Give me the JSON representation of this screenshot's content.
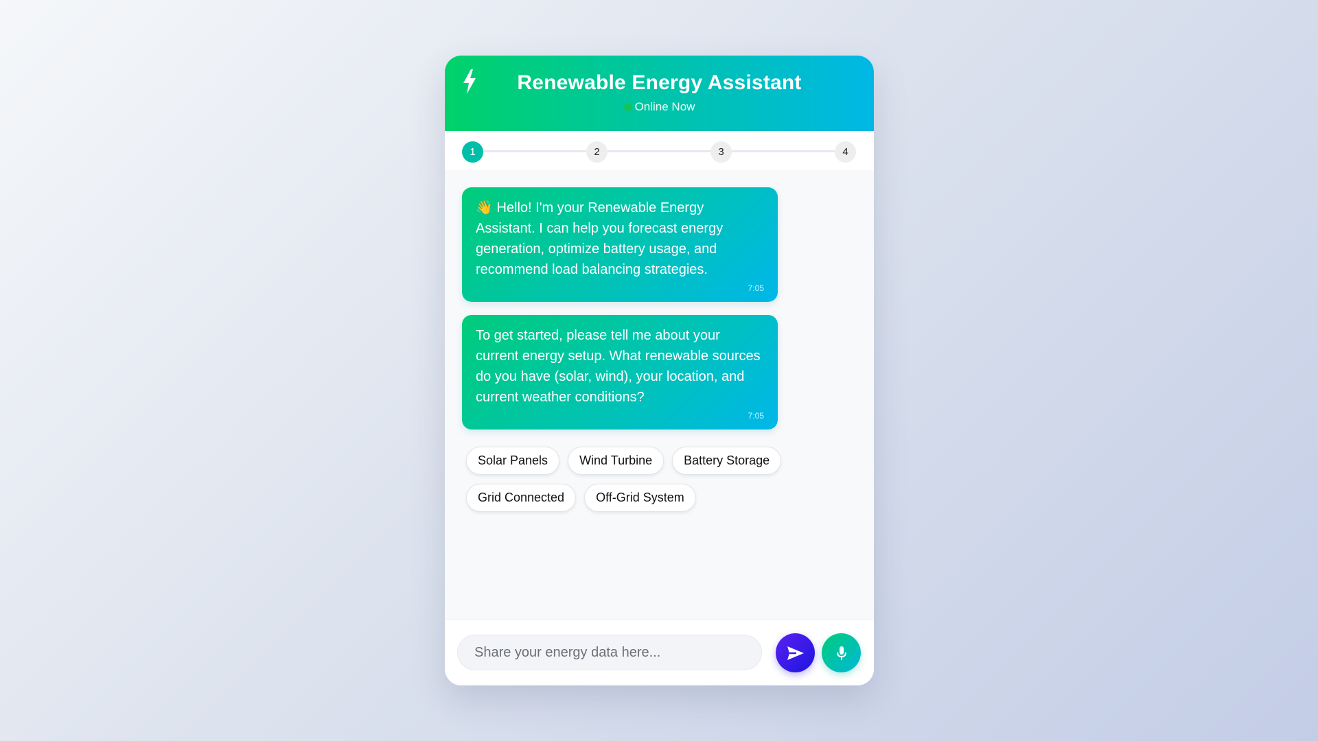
{
  "header": {
    "title": "Renewable Energy Assistant",
    "status": "Online Now",
    "icon": "lightning-bolt-icon"
  },
  "stepper": {
    "steps": [
      "1",
      "2",
      "3",
      "4"
    ],
    "active_step": 1
  },
  "messages": [
    {
      "text": "👋 Hello! I'm your Renewable Energy Assistant. I can help you forecast energy generation, optimize battery usage, and recommend load balancing strategies.",
      "time": "7:05"
    },
    {
      "text": "To get started, please tell me about your current energy setup. What renewable sources do you have (solar, wind), your location, and current weather conditions?",
      "time": "7:05"
    }
  ],
  "quick_replies": [
    "Solar Panels",
    "Wind Turbine",
    "Battery Storage",
    "Grid Connected",
    "Off-Grid System"
  ],
  "input": {
    "placeholder": "Share your energy data here...",
    "value": ""
  },
  "buttons": {
    "send_icon": "send-icon",
    "mic_icon": "microphone-icon"
  },
  "colors": {
    "header_gradient_start": "#00d26a",
    "header_gradient_end": "#00b8e6",
    "active_step": "#00bfa8",
    "send_button": "#3b18e8",
    "status_dot": "#12c45a"
  }
}
